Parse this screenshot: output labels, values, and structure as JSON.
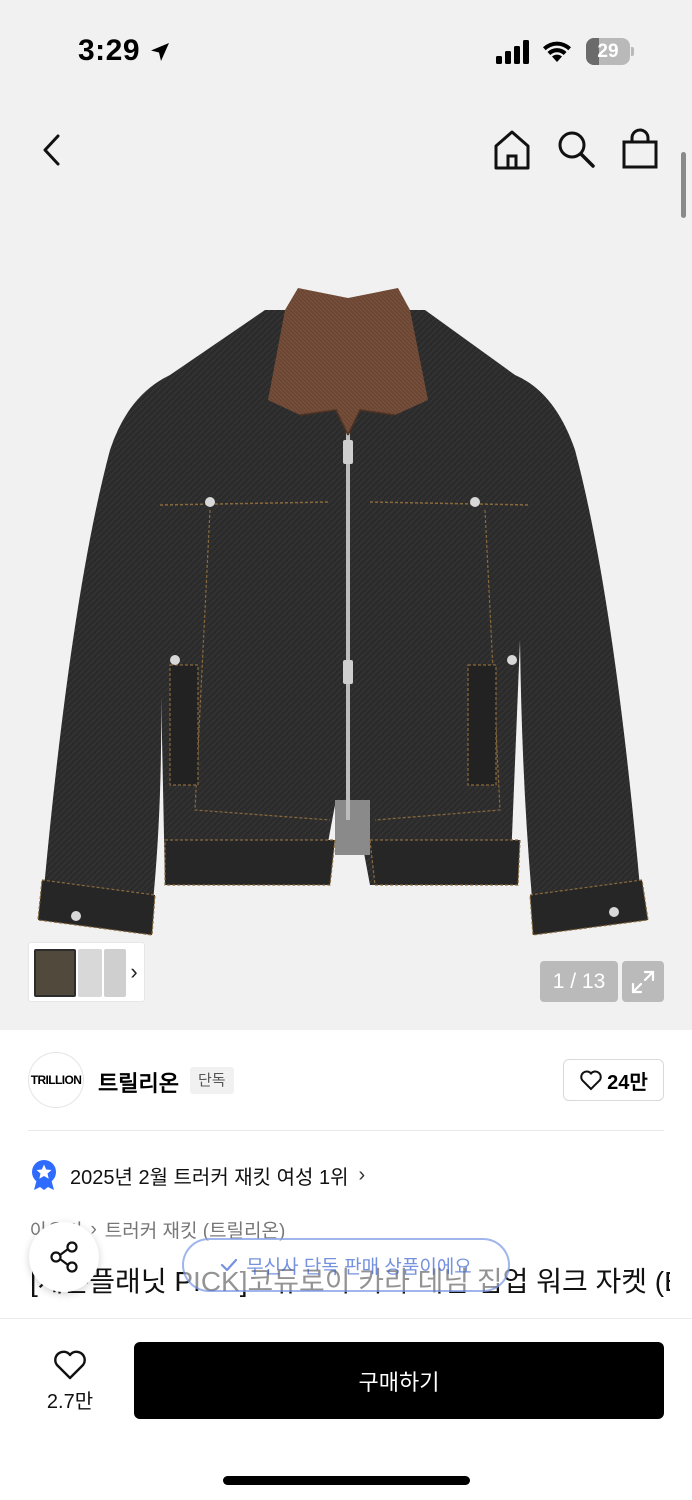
{
  "status": {
    "time": "3:29",
    "battery_level": "29",
    "location_icon": "location-arrow-icon",
    "signal_icon": "cellular-signal-icon",
    "wifi_icon": "wifi-icon"
  },
  "nav": {
    "back_icon": "chevron-left-icon",
    "home_icon": "home-icon",
    "search_icon": "search-icon",
    "bag_icon": "shopping-bag-icon"
  },
  "gallery": {
    "counter": "1 / 13",
    "expand_icon": "expand-icon",
    "thumb_chevron": "›"
  },
  "brand": {
    "logo_text": "TRILLION",
    "name": "트릴리온",
    "badge": "단독",
    "like_count": "24만"
  },
  "ranking": {
    "text": "2025년 2월 트러커 재킷 여성 1위",
    "chevron": "›"
  },
  "breadcrumb": {
    "level1": "아우터",
    "separator": "›",
    "level2": "트러커 재킷 (트릴리온)"
  },
  "product": {
    "title": "[세븐플래닛 PICK]코듀로이 카라 데님 집업 워크 자켓 (BLACK)"
  },
  "toast": {
    "text": "무신사 단독 판매 상품이에요"
  },
  "bottom": {
    "wish_count": "2.7만",
    "buy_label": "구매하기"
  },
  "colors": {
    "background": "#f1f1f1",
    "accent": "#000000",
    "ranking_badge": "#2f6bff"
  }
}
